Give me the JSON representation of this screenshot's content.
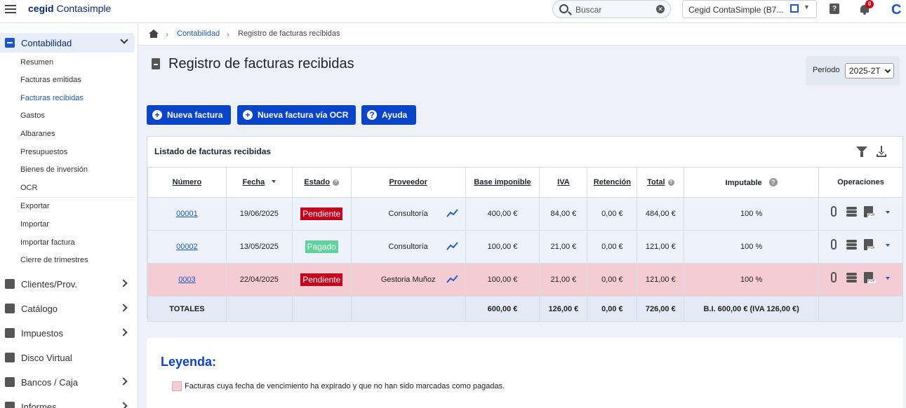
{
  "app": {
    "logo_brand": "cegid",
    "logo_product": "Contasimple",
    "search_placeholder": "Buscar",
    "company_name": "Cegid ContaSimple (B7...",
    "notifications_count": "0",
    "corner_mark": "C"
  },
  "sidebar": {
    "header": "Contabilidad",
    "items": [
      {
        "label": "Resumen"
      },
      {
        "label": "Facturas emitidas"
      },
      {
        "label": "Facturas recibidas"
      },
      {
        "label": "Gastos"
      },
      {
        "label": "Albaranes"
      },
      {
        "label": "Presupuestos"
      },
      {
        "label": "Bienes de inversión"
      },
      {
        "label": "OCR"
      },
      {
        "label": "Exportar"
      },
      {
        "label": "Importar"
      },
      {
        "label": "Importar factura"
      },
      {
        "label": "Cierre de trimestres"
      }
    ],
    "sections": [
      {
        "label": "Clientes/Prov."
      },
      {
        "label": "Catálogo"
      },
      {
        "label": "Impuestos"
      },
      {
        "label": "Disco Virtual"
      },
      {
        "label": "Bancos / Caja"
      },
      {
        "label": "Informes"
      }
    ]
  },
  "breadcrumb": {
    "parent": "Contabilidad",
    "current": "Registro de facturas recibidas"
  },
  "page": {
    "title": "Registro de facturas recibidas",
    "period_label": "Período",
    "period_value": "2025-2T"
  },
  "buttons": {
    "new_invoice": "Nueva factura",
    "new_invoice_ocr": "Nueva factura vía OCR",
    "help": "Ayuda"
  },
  "list": {
    "title": "Listado de facturas recibidas",
    "columns": {
      "numero": "Número",
      "fecha": "Fecha",
      "estado": "Estado",
      "proveedor": "Proveedor",
      "base": "Base imponible",
      "iva": "IVA",
      "retencion": "Retención",
      "total": "Total",
      "imputable": "Imputable",
      "operaciones": "Operaciones"
    },
    "rows": [
      {
        "numero": "00001",
        "fecha": "19/06/2025",
        "estado": "Pendiente",
        "proveedor": "Consultoría",
        "base": "400,00 €",
        "iva": "84,00 €",
        "retencion": "0,00 €",
        "total": "484,00 €",
        "imputable": "100 %"
      },
      {
        "numero": "00002",
        "fecha": "13/05/2025",
        "estado": "Pagado",
        "proveedor": "Consultoría",
        "base": "100,00 €",
        "iva": "21,00 €",
        "retencion": "0,00 €",
        "total": "121,00 €",
        "imputable": "100 %"
      },
      {
        "numero": "0003",
        "fecha": "22/04/2025",
        "estado": "Pendiente",
        "proveedor": "Gestoria Muñoz",
        "base": "100,00 €",
        "iva": "21,00 €",
        "retencion": "0,00 €",
        "total": "121,00 €",
        "imputable": "100 %"
      }
    ],
    "totals": {
      "label": "TOTALES",
      "base": "600,00 €",
      "iva": "126,00 €",
      "retencion": "0,00 €",
      "total": "726,00 €",
      "imputable": "B.I. 600,00 € (IVA 126,00 €)"
    }
  },
  "legend": {
    "title": "Leyenda:",
    "expired_text": "Facturas cuya fecha de vencimiento ha expirado y que no han sido marcadas como pagadas."
  }
}
